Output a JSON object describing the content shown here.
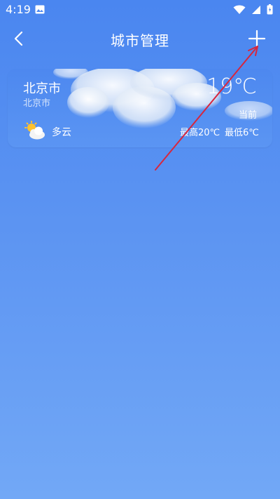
{
  "status_bar": {
    "time": "4:19"
  },
  "appbar": {
    "title": "城市管理"
  },
  "city_card": {
    "city": "北京市",
    "region": "北京市",
    "temperature": "19℃",
    "current_label": "当前",
    "condition": "多云",
    "high": "最高20℃",
    "low": "最低6℃"
  },
  "colors": {
    "background_top": "#4a86f0",
    "background_bottom": "#72a8f6",
    "annotation_arrow": "#d7263d"
  }
}
